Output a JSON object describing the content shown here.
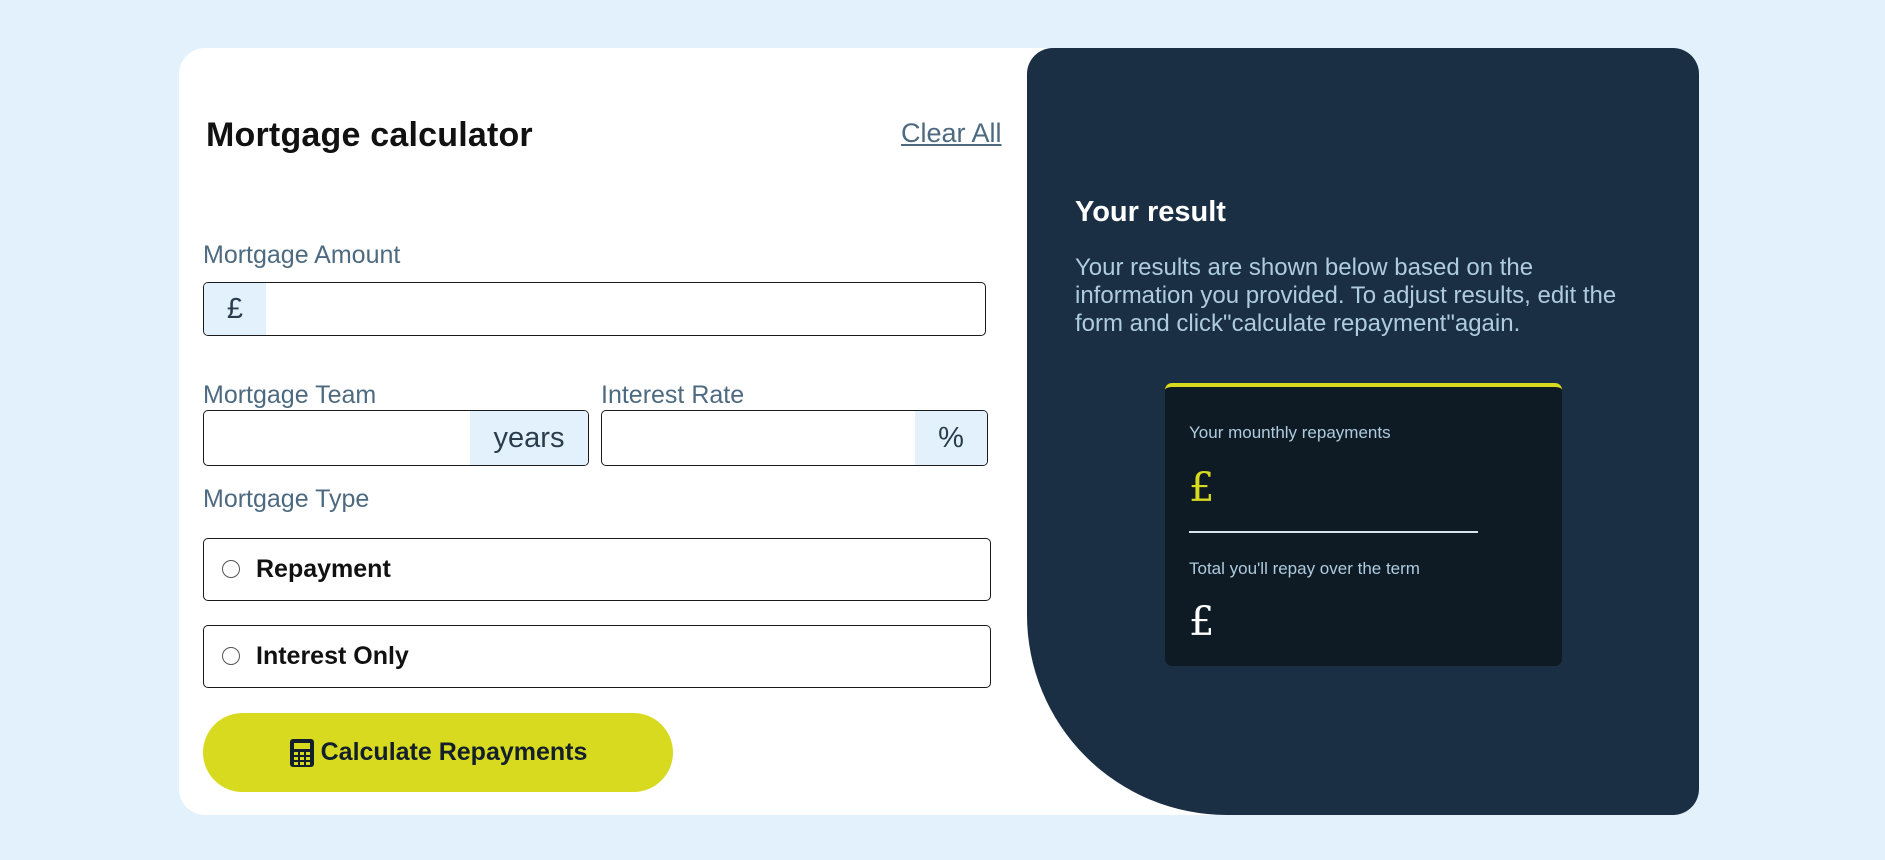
{
  "form": {
    "title": "Mortgage calculator",
    "clear_label": "Clear All",
    "amount": {
      "label": "Mortgage Amount",
      "prefix": "£",
      "value": ""
    },
    "term": {
      "label": "Mortgage Team",
      "suffix": "years",
      "value": ""
    },
    "rate": {
      "label": "Interest Rate",
      "suffix": "%",
      "value": ""
    },
    "type": {
      "label": "Mortgage Type",
      "options": [
        {
          "label": "Repayment",
          "selected": false
        },
        {
          "label": "Interest Only",
          "selected": false
        }
      ]
    },
    "submit_label": "Calculate Repayments",
    "submit_icon": "calculator-icon"
  },
  "result": {
    "title": "Your result",
    "description": "Your results are shown below based on the information you provided. To adjust results, edit the form and click\"calculate repayment\"again.",
    "monthly_label": "Your mounthly repayments",
    "monthly_value": "£",
    "total_label": "Total you'll repay over the term",
    "total_value": "£"
  },
  "colors": {
    "background": "#e3f1fd",
    "accent": "#d7da1f",
    "panel": "#1a2f43",
    "result_box": "#0f1b24",
    "label": "#4d6a80"
  }
}
